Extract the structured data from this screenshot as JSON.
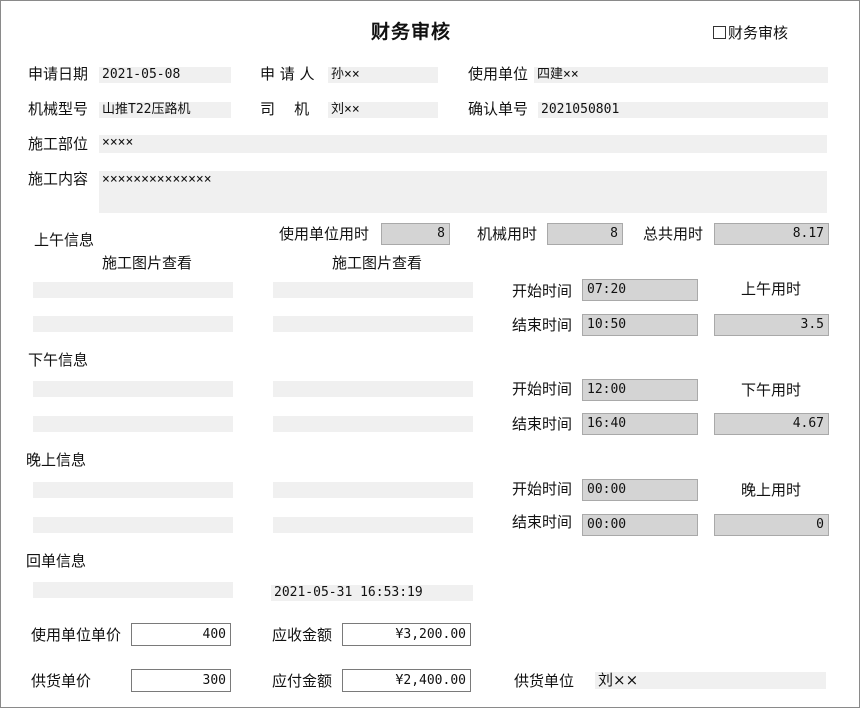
{
  "title": "财务审核",
  "finance_checkbox": {
    "label": "财务审核",
    "checked": false
  },
  "header": {
    "apply_date_label": "申请日期",
    "apply_date": "2021-05-08",
    "applicant_label": "申 请 人",
    "applicant": "孙××",
    "unit_label": "使用单位",
    "unit": "四建××",
    "machine_label": "机械型号",
    "machine": "山推T22压路机",
    "driver_label": "司    机",
    "driver": "刘××",
    "confirm_no_label": "确认单号",
    "confirm_no": "2021050801",
    "site_label": "施工部位",
    "site": "××××",
    "content_label": "施工内容",
    "content": "××××××××××××××"
  },
  "totals": {
    "unit_hours_label": "使用单位用时",
    "unit_hours": "8",
    "machine_hours_label": "机械用时",
    "machine_hours": "8",
    "total_hours_label": "总共用时",
    "total_hours": "8.17"
  },
  "morning": {
    "section_label": "上午信息",
    "photo_link_1": "施工图片查看",
    "photo_link_2": "施工图片查看",
    "start_label": "开始时间",
    "start": "07:20",
    "end_label": "结束时间",
    "end": "10:50",
    "hours_label": "上午用时",
    "hours": "3.5"
  },
  "afternoon": {
    "section_label": "下午信息",
    "start_label": "开始时间",
    "start": "12:00",
    "end_label": "结束时间",
    "end": "16:40",
    "hours_label": "下午用时",
    "hours": "4.67"
  },
  "evening": {
    "section_label": "晚上信息",
    "start_label": "开始时间",
    "start": "00:00",
    "end_label": "结束时间",
    "end": "00:00",
    "hours_label": "晚上用时",
    "hours": "0"
  },
  "return": {
    "section_label": "回单信息",
    "timestamp": "2021-05-31 16:53:19"
  },
  "pricing": {
    "unit_price_label": "使用单位单价",
    "unit_price": "400",
    "receivable_label": "应收金额",
    "receivable": "¥3,200.00",
    "supply_price_label": "供货单价",
    "supply_price": "300",
    "payable_label": "应付金额",
    "payable": "¥2,400.00",
    "supplier_label": "供货单位",
    "supplier": "刘××"
  }
}
